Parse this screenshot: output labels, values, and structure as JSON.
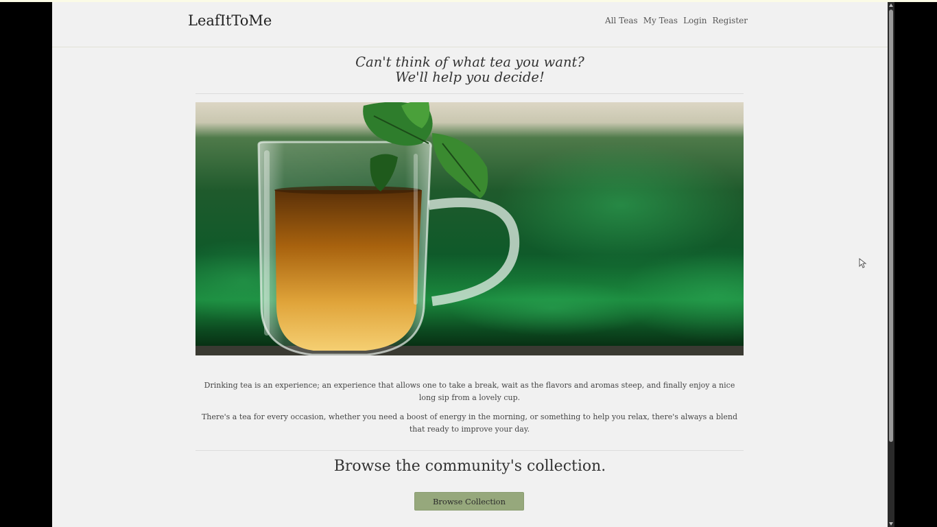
{
  "brand": "LeafItToMe",
  "nav": {
    "all_teas": "All Teas",
    "my_teas": "My Teas",
    "login": "Login",
    "register": "Register"
  },
  "hero": {
    "heading_line1": "Can't think of what tea you want?",
    "heading_line2": "We'll help you decide!",
    "image_alt": "Glass cup of tea with mint leaves"
  },
  "intro": {
    "paragraph1": "Drinking tea is an experience; an experience that allows one to take a break, wait as the flavors and aromas steep, and finally enjoy a nice long sip from a lovely cup.",
    "paragraph2": "There's a tea for every occasion, whether you need a boost of energy in the morning, or something to help you relax, there's always a blend that ready to improve your day."
  },
  "collection": {
    "title": "Browse the community's collection.",
    "button_label": "Browse Collection"
  },
  "colors": {
    "page_bg": "#f1f1f1",
    "button_bg": "#96a87c",
    "text": "#333333"
  }
}
